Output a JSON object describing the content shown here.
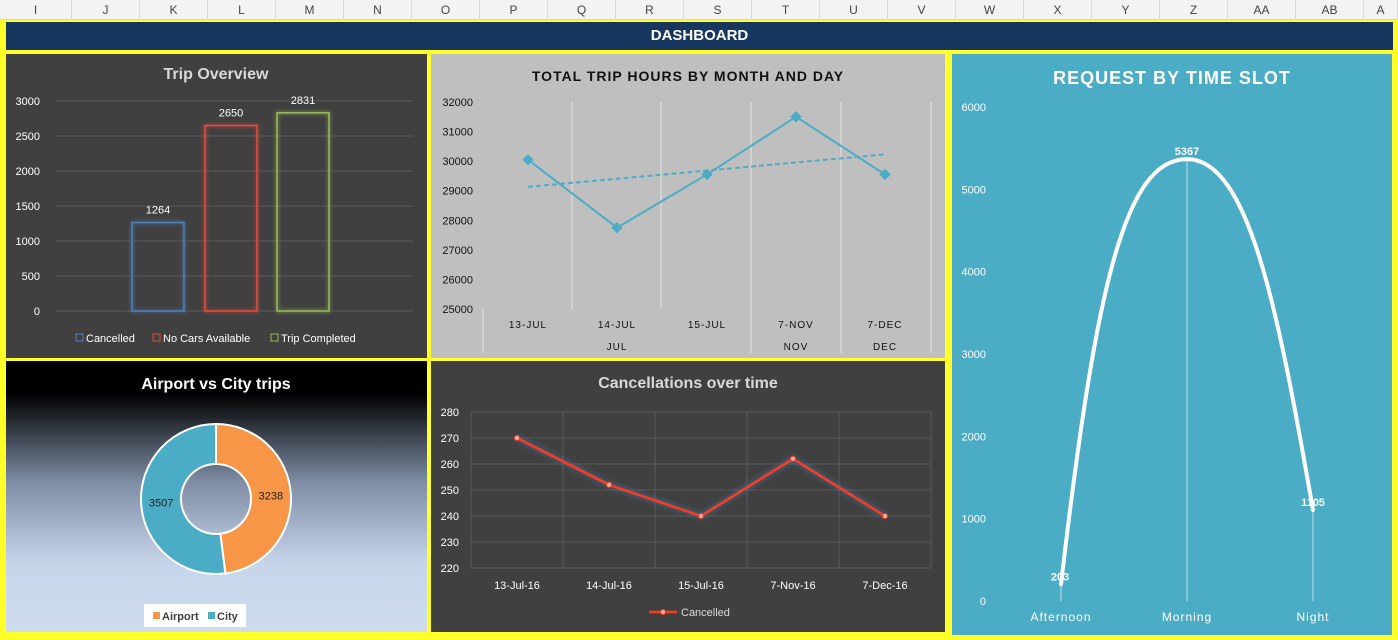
{
  "columns": [
    "I",
    "J",
    "K",
    "L",
    "M",
    "N",
    "O",
    "P",
    "Q",
    "R",
    "S",
    "T",
    "U",
    "V",
    "W",
    "X",
    "Y",
    "Z",
    "AA",
    "AB",
    "A"
  ],
  "dashboard_title": "DASHBOARD",
  "colors": {
    "frame": "#ffff2a",
    "title_bg": "#17375e",
    "dark_panel": "#404040",
    "grey_panel": "#bfbfbf",
    "teal_panel": "#4bacc6",
    "orange": "#f79646",
    "teal": "#4bacc6",
    "red": "#ff3b1f"
  },
  "trip_overview": {
    "chart_data": {
      "type": "bar",
      "title": "Trip Overview",
      "categories": [
        "Cancelled",
        "No Cars Available",
        "Trip Completed"
      ],
      "values": [
        1264,
        2650,
        2831
      ],
      "colors": [
        "#4f81bd",
        "#e84c3d",
        "#9bbb59"
      ],
      "ylim": [
        0,
        3000
      ],
      "yticks": [
        "0",
        "500",
        "1000",
        "1500",
        "2000",
        "2500",
        "3000"
      ],
      "legend_position": "bottom",
      "grid": true
    }
  },
  "trip_hours": {
    "chart_data": {
      "type": "line",
      "title": "TOTAL TRIP HOURS BY MONTH AND DAY",
      "categories": [
        "13-JUL",
        "14-JUL",
        "15-JUL",
        "7-NOV",
        "7-DEC"
      ],
      "groups": [
        "JUL",
        "NOV",
        "DEC"
      ],
      "values": [
        30050,
        27750,
        29550,
        31500,
        29550
      ],
      "ylim": [
        25000,
        32000
      ],
      "yticks": [
        "25000",
        "26000",
        "27000",
        "28000",
        "29000",
        "30000",
        "31000",
        "32000"
      ],
      "trendline": true
    }
  },
  "request_time": {
    "chart_data": {
      "type": "line",
      "title": "REQUEST BY TIME SLOT",
      "categories": [
        "Afternoon",
        "Morning",
        "Night"
      ],
      "values": [
        203,
        5367,
        1105
      ],
      "value_labels": [
        "203",
        "5367",
        "1105"
      ],
      "ylim": [
        0,
        6000
      ],
      "yticks": [
        "0",
        "1000",
        "2000",
        "3000",
        "4000",
        "5000",
        "6000"
      ],
      "smooth": true
    }
  },
  "airport_city": {
    "chart_data": {
      "type": "pie",
      "title": "Airport vs City trips",
      "labels": [
        "Airport",
        "City"
      ],
      "values": [
        3238,
        3507
      ],
      "colors": [
        "#f79646",
        "#4bacc6"
      ],
      "donut": true,
      "legend_position": "bottom"
    }
  },
  "cancellations": {
    "chart_data": {
      "type": "line",
      "title": "Cancellations over time",
      "categories": [
        "13-Jul-16",
        "14-Jul-16",
        "15-Jul-16",
        "7-Nov-16",
        "7-Dec-16"
      ],
      "series": [
        {
          "name": "Cancelled",
          "values": [
            270,
            252,
            240,
            262,
            240
          ]
        }
      ],
      "ylim": [
        220,
        280
      ],
      "yticks": [
        "220",
        "230",
        "240",
        "250",
        "260",
        "270",
        "280"
      ],
      "legend_position": "bottom",
      "grid": true
    }
  }
}
